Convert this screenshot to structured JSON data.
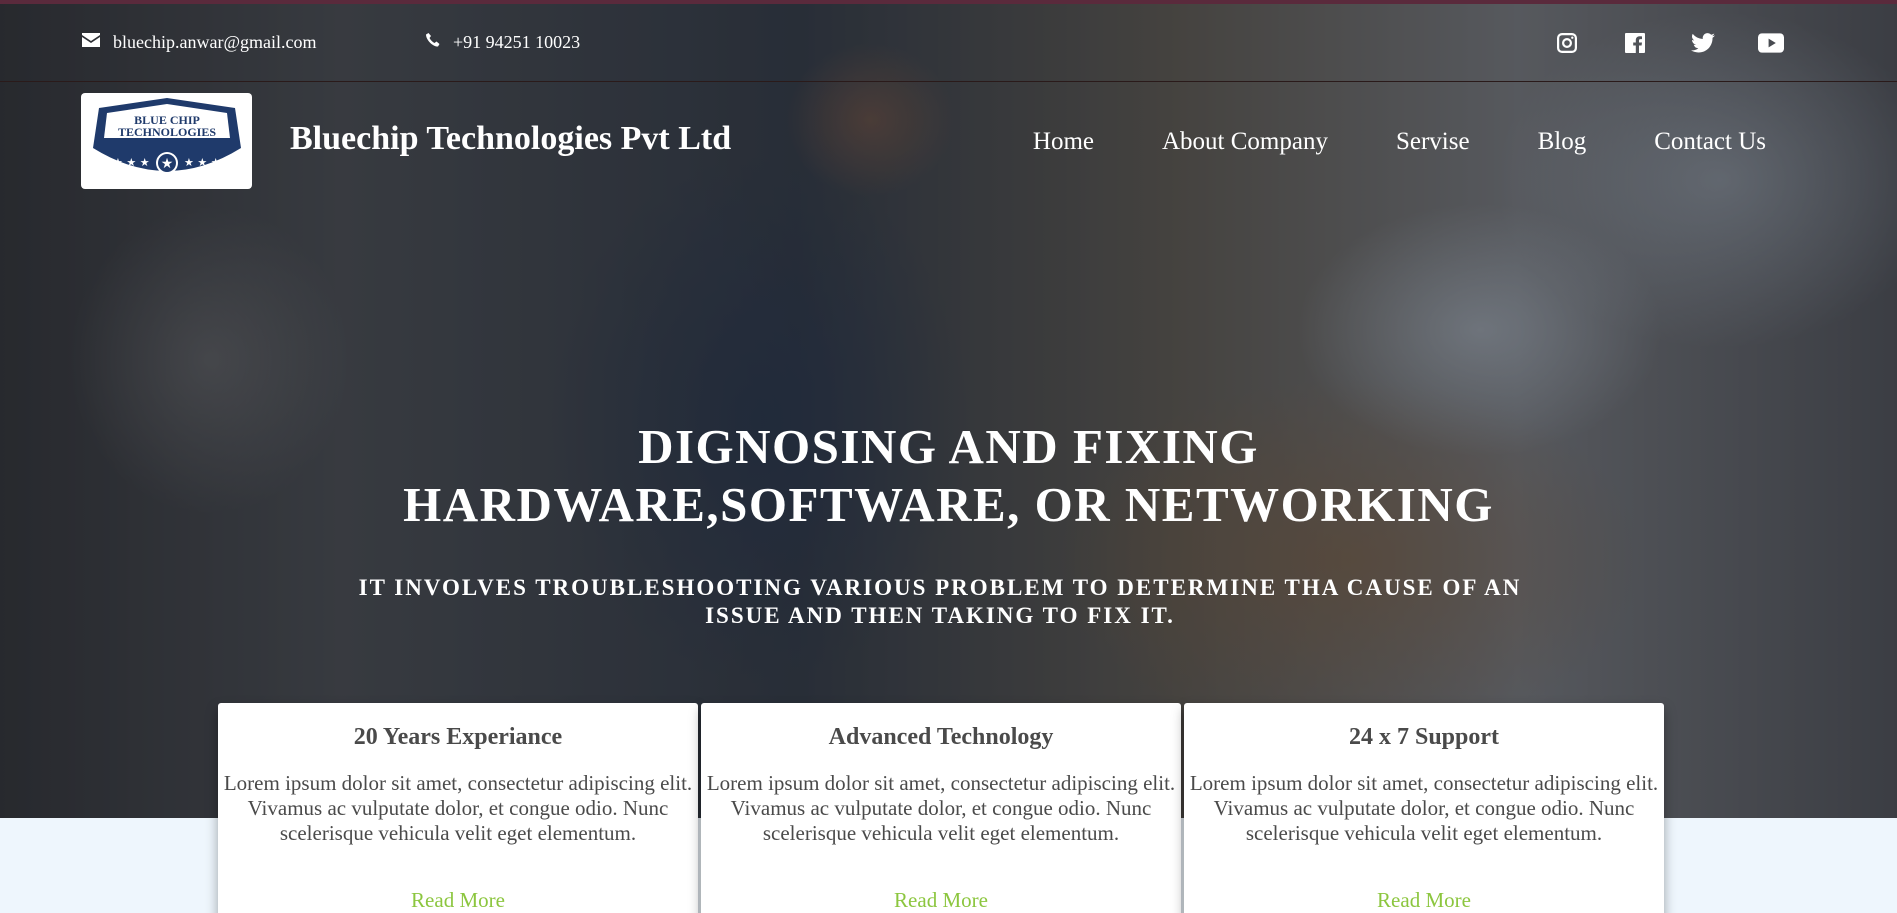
{
  "contact": {
    "email": "bluechip.anwar@gmail.com",
    "phone": "+91 94251 10023"
  },
  "social_icons": [
    "instagram-icon",
    "facebook-icon",
    "twitter-icon",
    "youtube-icon"
  ],
  "logo": {
    "line1": "BLUE CHIP",
    "line2": "TECHNOLOGIES"
  },
  "brand": "Bluechip Technologies Pvt Ltd",
  "nav": {
    "items": [
      "Home",
      "About Company",
      "Servise",
      "Blog",
      "Contact Us"
    ]
  },
  "hero": {
    "headline_line1": "DIGNOSING AND FIXING",
    "headline_line2": "HARDWARE,SOFTWARE, OR NETWORKING",
    "subline": "IT INVOLVES TROUBLESHOOTING VARIOUS PROBLEM TO DETERMINE THA CAUSE OF AN ISSUE AND THEN TAKING TO FIX IT."
  },
  "cards": [
    {
      "title": "20 Years Experiance",
      "text": "Lorem ipsum dolor sit amet, consectetur adipiscing elit. Vivamus ac vulputate dolor, et congue odio. Nunc scelerisque vehicula velit eget elementum.",
      "link": "Read More"
    },
    {
      "title": "Advanced Technology",
      "text": "Lorem ipsum dolor sit amet, consectetur adipiscing elit. Vivamus ac vulputate dolor, et congue odio. Nunc scelerisque vehicula velit eget elementum.",
      "link": "Read More"
    },
    {
      "title": "24 x 7 Support",
      "text": "Lorem ipsum dolor sit amet, consectetur adipiscing elit. Vivamus ac vulputate dolor, et congue odio. Nunc scelerisque vehicula velit eget elementum.",
      "link": "Read More"
    }
  ],
  "colors": {
    "accent_link": "#8cc63f",
    "logo_navy": "#1f3a6b",
    "top_rule": "#5a2a3c",
    "page_bg": "#eef6fd"
  }
}
